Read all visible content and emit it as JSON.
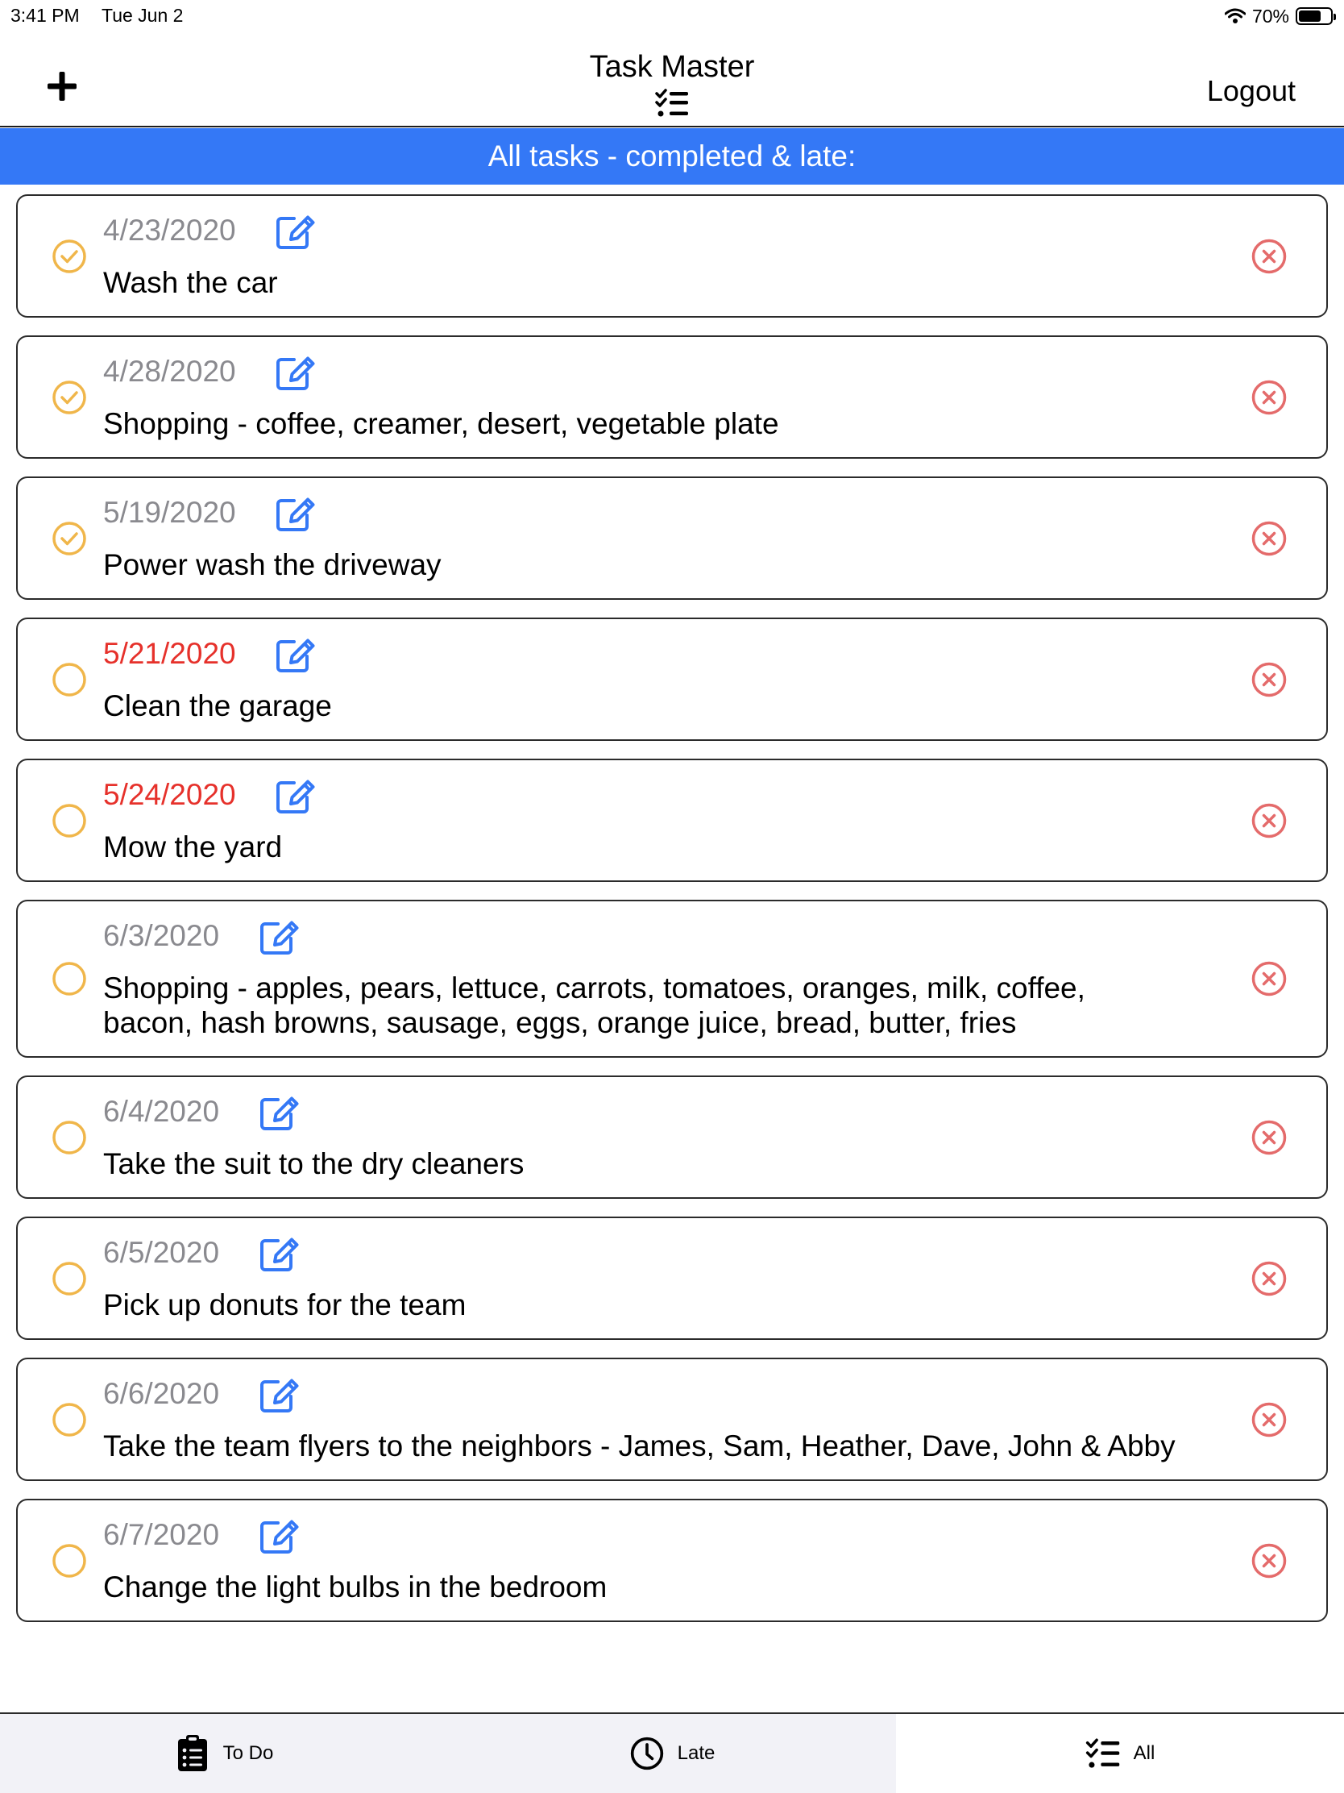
{
  "status_bar": {
    "time": "3:41 PM",
    "date": "Tue Jun 2",
    "battery_percent": "70%",
    "battery_level": 0.7
  },
  "header": {
    "title": "Task Master",
    "logout_label": "Logout",
    "add_icon": "plus-icon",
    "title_icon": "checklist-icon"
  },
  "banner": {
    "text": "All tasks - completed & late:",
    "color": "#3478f6"
  },
  "colors": {
    "completed_check": "#f0b64a",
    "pending_circle": "#f0b64a",
    "late_date": "#e6312b",
    "normal_date": "#8a8a8f",
    "edit_icon": "#3478f6",
    "delete_icon": "#e46b6b"
  },
  "tasks": [
    {
      "date": "4/23/2020",
      "text": "Wash the car",
      "completed": true,
      "late": false
    },
    {
      "date": "4/28/2020",
      "text": "Shopping - coffee, creamer, desert, vegetable plate",
      "completed": true,
      "late": false
    },
    {
      "date": "5/19/2020",
      "text": "Power wash the driveway",
      "completed": true,
      "late": false
    },
    {
      "date": "5/21/2020",
      "text": "Clean the garage",
      "completed": false,
      "late": true
    },
    {
      "date": "5/24/2020",
      "text": "Mow the yard",
      "completed": false,
      "late": true
    },
    {
      "date": "6/3/2020",
      "text": "Shopping - apples, pears, lettuce, carrots, tomatoes, oranges, milk, coffee, bacon, hash browns, sausage, eggs, orange juice, bread, butter, fries",
      "completed": false,
      "late": false
    },
    {
      "date": "6/4/2020",
      "text": "Take the suit to the dry cleaners",
      "completed": false,
      "late": false
    },
    {
      "date": "6/5/2020",
      "text": "Pick up donuts for the team",
      "completed": false,
      "late": false
    },
    {
      "date": "6/6/2020",
      "text": "Take the team flyers to the neighbors - James, Sam, Heather, Dave, John & Abby",
      "completed": false,
      "late": false
    },
    {
      "date": "6/7/2020",
      "text": "Change the light bulbs in the bedroom",
      "completed": false,
      "late": false
    }
  ],
  "tab_bar": {
    "tabs": [
      {
        "label": "To Do",
        "icon": "clipboard-list-icon",
        "selected": false
      },
      {
        "label": "Late",
        "icon": "clock-icon",
        "selected": false
      },
      {
        "label": "All",
        "icon": "checklist-icon",
        "selected": true
      }
    ]
  }
}
